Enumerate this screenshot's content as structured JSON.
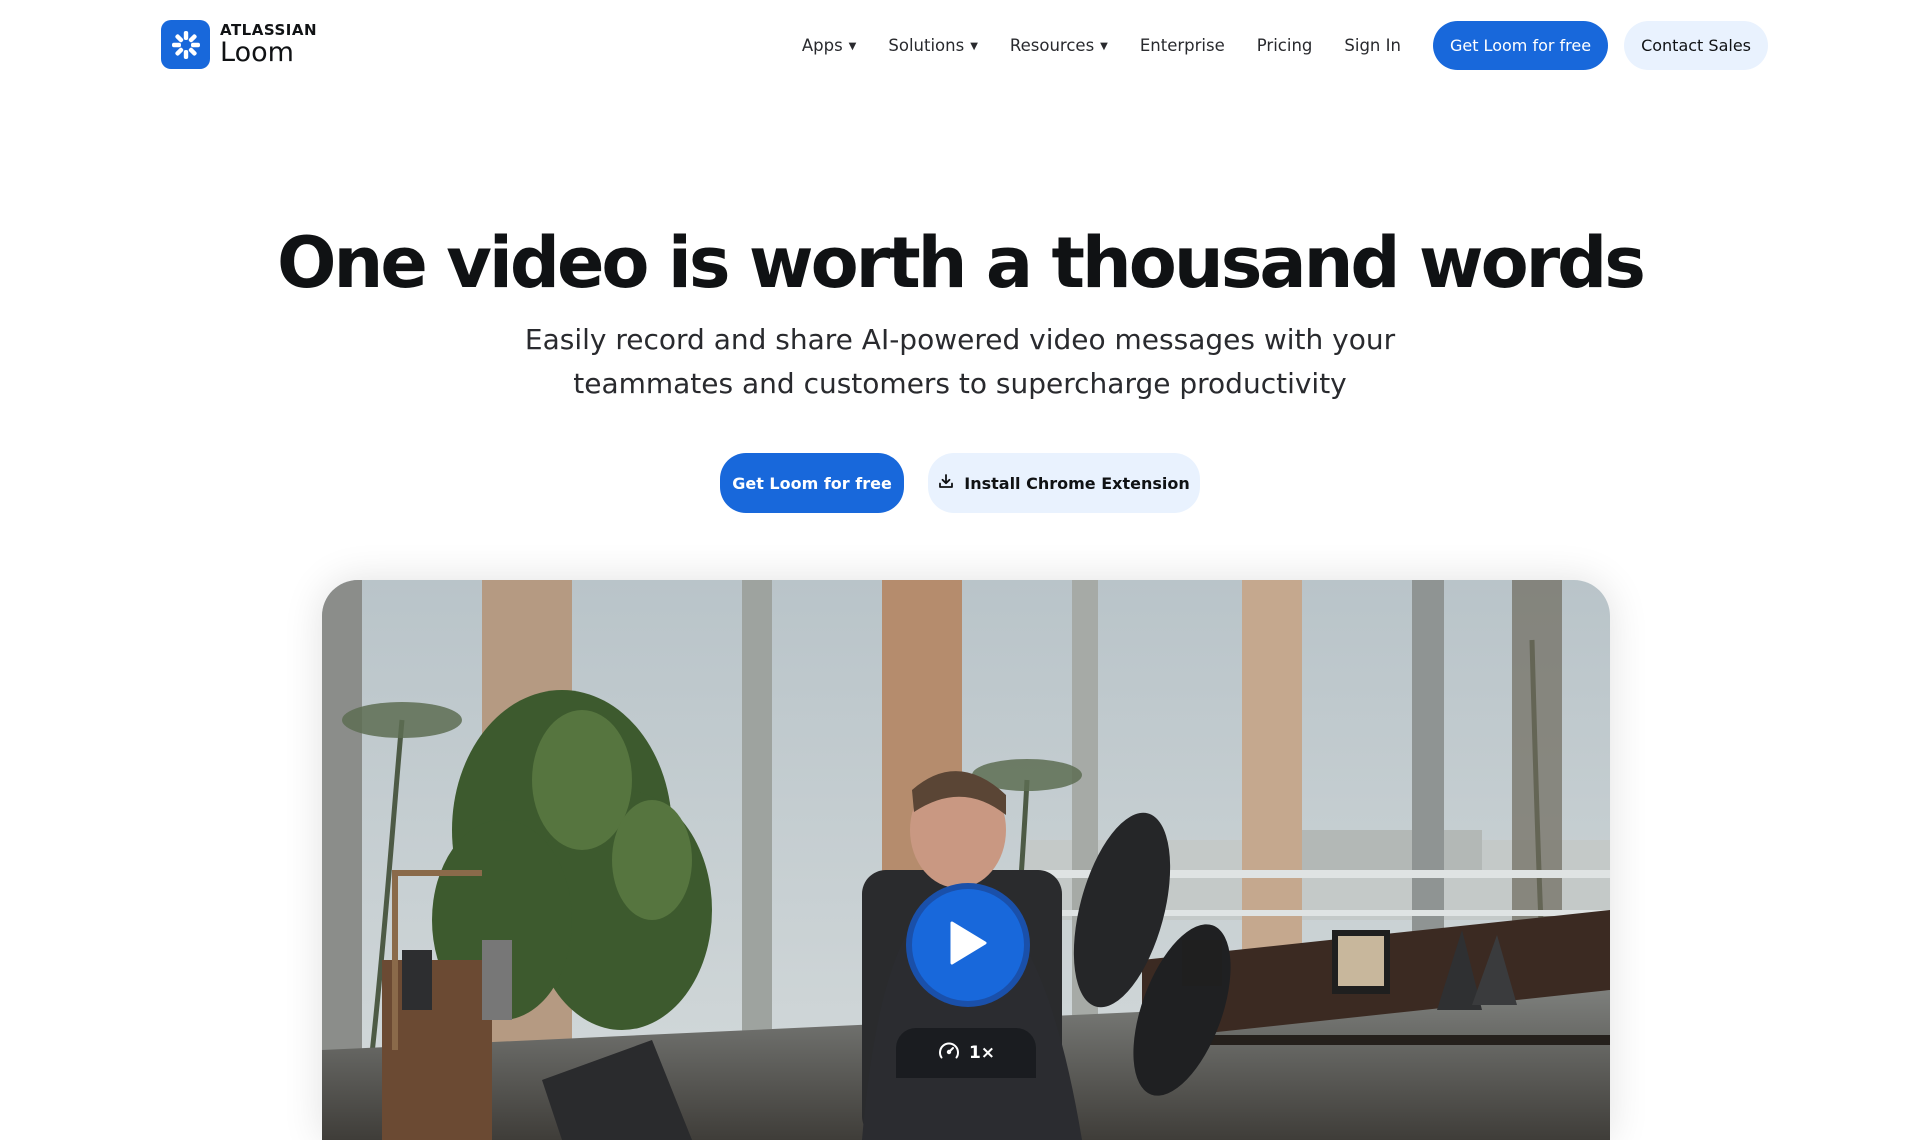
{
  "logo": {
    "brand": "ATLASSIAN",
    "product": "Loom",
    "icon": "loom-logo-icon"
  },
  "nav": {
    "items": [
      {
        "label": "Apps",
        "dropdown": true
      },
      {
        "label": "Solutions",
        "dropdown": true
      },
      {
        "label": "Resources",
        "dropdown": true
      },
      {
        "label": "Enterprise",
        "dropdown": false
      },
      {
        "label": "Pricing",
        "dropdown": false
      },
      {
        "label": "Sign In",
        "dropdown": false
      }
    ],
    "cta_primary": "Get Loom for free",
    "cta_secondary": "Contact Sales"
  },
  "hero": {
    "title": "One video is worth a thousand words",
    "subtitle_line1": "Easily record and share AI-powered video messages with your",
    "subtitle_line2": "teammates and customers to supercharge productivity",
    "cta_primary": "Get Loom for free",
    "cta_secondary": "Install Chrome Extension",
    "cta_secondary_icon": "download-icon"
  },
  "video": {
    "play_icon": "play-icon",
    "speed_icon": "playback-speed-icon",
    "speed_label": "1×"
  },
  "colors": {
    "brand_blue": "#1868db",
    "secondary_bg": "#e9f2fe",
    "text_dark": "#101214"
  }
}
